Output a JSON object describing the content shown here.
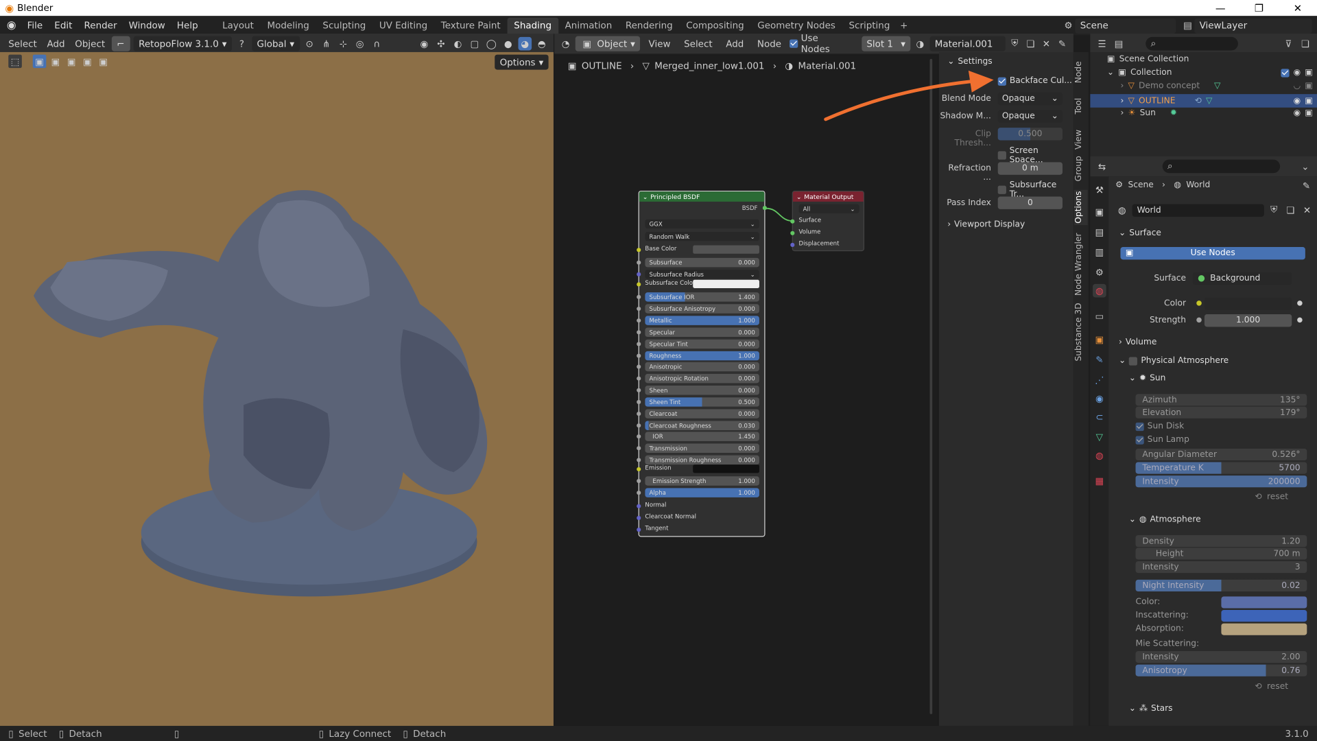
{
  "window": {
    "title": "Blender"
  },
  "menus": [
    "File",
    "Edit",
    "Render",
    "Window",
    "Help"
  ],
  "workspaces": [
    "Layout",
    "Modeling",
    "Sculpting",
    "UV Editing",
    "Texture Paint",
    "Shading",
    "Animation",
    "Rendering",
    "Compositing",
    "Geometry Nodes",
    "Scripting"
  ],
  "active_workspace": "Shading",
  "scene": {
    "name": "Scene",
    "view_layer": "ViewLayer"
  },
  "viewport_header": {
    "select": "Select",
    "add": "Add",
    "object": "Object",
    "addon": "RetopoFlow 3.1.0",
    "orientation": "Global",
    "options": "Options"
  },
  "node_header": {
    "object_mode": "Object",
    "view": "View",
    "select": "Select",
    "add": "Add",
    "node": "Node",
    "use_nodes": "Use Nodes",
    "slot": "Slot 1",
    "material": "Material.001"
  },
  "breadcrumb": [
    "OUTLINE",
    "Merged_inner_low1.001",
    "Material.001"
  ],
  "principled": {
    "title": "Principled BSDF",
    "output": "BSDF",
    "distribution": "GGX",
    "subsurface_method": "Random Walk",
    "rows": [
      {
        "label": "Subsurface",
        "value": "0.000",
        "fill": 0
      },
      {
        "label": "Subsurface Radius",
        "value": "",
        "fill": 0
      },
      {
        "label": "Subsurface IOR",
        "value": "1.400",
        "fill": 0.35
      },
      {
        "label": "Subsurface Anisotropy",
        "value": "0.000",
        "fill": 0
      },
      {
        "label": "Metallic",
        "value": "1.000",
        "fill": 1
      },
      {
        "label": "Specular",
        "value": "0.000",
        "fill": 0
      },
      {
        "label": "Specular Tint",
        "value": "0.000",
        "fill": 0
      },
      {
        "label": "Roughness",
        "value": "1.000",
        "fill": 1
      },
      {
        "label": "Anisotropic",
        "value": "0.000",
        "fill": 0
      },
      {
        "label": "Anisotropic Rotation",
        "value": "0.000",
        "fill": 0
      },
      {
        "label": "Sheen",
        "value": "0.000",
        "fill": 0
      },
      {
        "label": "Sheen Tint",
        "value": "0.500",
        "fill": 0.5
      },
      {
        "label": "Clearcoat",
        "value": "0.000",
        "fill": 0
      },
      {
        "label": "Clearcoat Roughness",
        "value": "0.030",
        "fill": 0.03
      },
      {
        "label": "IOR",
        "value": "1.450",
        "fill": 0
      },
      {
        "label": "Transmission",
        "value": "0.000",
        "fill": 0
      },
      {
        "label": "Transmission Roughness",
        "value": "0.000",
        "fill": 0
      }
    ],
    "base_color": "Base Color",
    "subsurface_color": "Subsurface Colo",
    "emission": "Emission",
    "emission_strength": {
      "label": "Emission Strength",
      "value": "1.000"
    },
    "alpha": {
      "label": "Alpha",
      "value": "1.000"
    },
    "inputs_bottom": [
      "Normal",
      "Clearcoat Normal",
      "Tangent"
    ]
  },
  "material_output": {
    "title": "Material Output",
    "target": "All",
    "sockets": [
      "Surface",
      "Volume",
      "Displacement"
    ]
  },
  "settings_panel": {
    "title": "Settings",
    "backface": "Backface Cul...",
    "blend_label": "Blend Mode",
    "blend_value": "Opaque",
    "shadow_label": "Shadow M...",
    "shadow_value": "Opaque",
    "clip_label": "Clip Thresh...",
    "clip_value": "0.500",
    "screen_space": "Screen Space...",
    "refraction_label": "Refraction ...",
    "refraction_value": "0 m",
    "subsurface_tr": "Subsurface Tr...",
    "pass_label": "Pass Index",
    "pass_value": "0",
    "viewport_display": "Viewport Display"
  },
  "side_tabs": [
    "Node",
    "Tool",
    "View",
    "Group",
    "Options",
    "Node Wrangler",
    "Substance 3D"
  ],
  "outliner": {
    "root": "Scene Collection",
    "collection": "Collection",
    "items": [
      "Demo concept",
      "OUTLINE",
      "Sun"
    ]
  },
  "properties": {
    "scene": "Scene",
    "world": "World",
    "world_name": "World",
    "surface_section": "Surface",
    "use_nodes": "Use Nodes",
    "surface_label": "Surface",
    "surface_value": "Background",
    "color_label": "Color",
    "strength_label": "Strength",
    "strength_value": "1.000",
    "volume": "Volume",
    "phys_atmo": "Physical Atmosphere",
    "sun": "Sun",
    "sun_rows": [
      {
        "label": "Azimuth",
        "value": "135°",
        "fill": 0
      },
      {
        "label": "Elevation",
        "value": "179°",
        "fill": 0
      }
    ],
    "sun_disk": "Sun Disk",
    "sun_lamp": "Sun Lamp",
    "sun_rows2": [
      {
        "label": "Angular Diameter",
        "value": "0.526°",
        "fill": 0
      },
      {
        "label": "Temperature K",
        "value": "5700",
        "fill": 0.5
      },
      {
        "label": "Intensity",
        "value": "200000",
        "fill": 1
      }
    ],
    "reset": "reset",
    "atmosphere": "Atmosphere",
    "atmo_rows": [
      {
        "label": "Density",
        "value": "1.20"
      },
      {
        "label": "Height",
        "value": "700 m"
      },
      {
        "label": "Intensity",
        "value": "3"
      }
    ],
    "night": {
      "label": "Night Intensity",
      "value": "0.02",
      "fill": 0.5
    },
    "color_rows": [
      {
        "label": "Color:",
        "color": "#5a6da8"
      },
      {
        "label": "Inscattering:",
        "color": "#3d64b8"
      },
      {
        "label": "Absorption:",
        "color": "#b5a27e"
      }
    ],
    "mie": "Mie Scattering:",
    "mie_rows": [
      {
        "label": "Intensity",
        "value": "2.00",
        "fill": 0
      },
      {
        "label": "Anisotropy",
        "value": "0.76",
        "fill": 0.76
      }
    ],
    "stars": "Stars"
  },
  "status": {
    "select": "Select",
    "detach": "Detach",
    "lazy": "Lazy Connect",
    "detach2": "Detach",
    "version": "3.1.0"
  },
  "colors": {
    "accent": "#4772b3",
    "arrow": "#f07030",
    "viewport": "#8c6f47"
  }
}
